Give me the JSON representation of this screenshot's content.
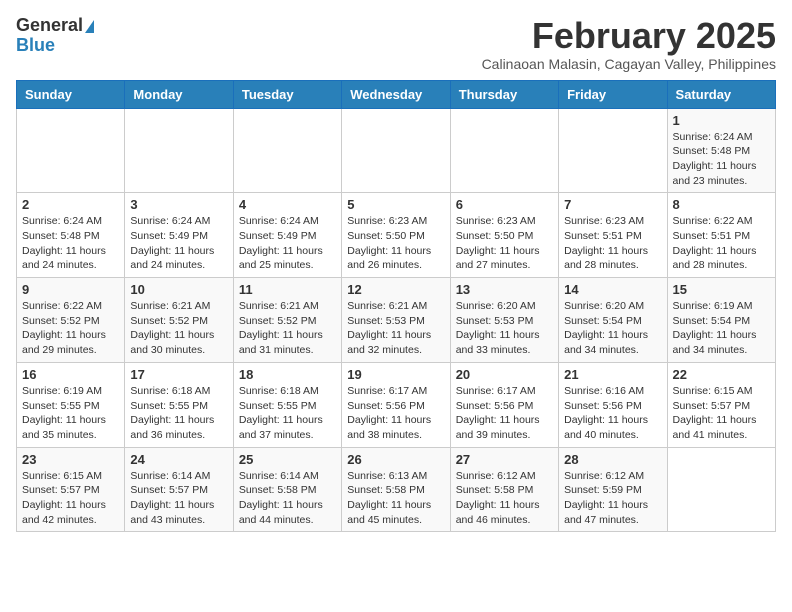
{
  "header": {
    "logo_line1": "General",
    "logo_line2": "Blue",
    "title": "February 2025",
    "subtitle": "Calinaoan Malasin, Cagayan Valley, Philippines"
  },
  "calendar": {
    "days_of_week": [
      "Sunday",
      "Monday",
      "Tuesday",
      "Wednesday",
      "Thursday",
      "Friday",
      "Saturday"
    ],
    "weeks": [
      [
        {
          "day": "",
          "info": ""
        },
        {
          "day": "",
          "info": ""
        },
        {
          "day": "",
          "info": ""
        },
        {
          "day": "",
          "info": ""
        },
        {
          "day": "",
          "info": ""
        },
        {
          "day": "",
          "info": ""
        },
        {
          "day": "1",
          "info": "Sunrise: 6:24 AM\nSunset: 5:48 PM\nDaylight: 11 hours and 23 minutes."
        }
      ],
      [
        {
          "day": "2",
          "info": "Sunrise: 6:24 AM\nSunset: 5:48 PM\nDaylight: 11 hours and 24 minutes."
        },
        {
          "day": "3",
          "info": "Sunrise: 6:24 AM\nSunset: 5:49 PM\nDaylight: 11 hours and 24 minutes."
        },
        {
          "day": "4",
          "info": "Sunrise: 6:24 AM\nSunset: 5:49 PM\nDaylight: 11 hours and 25 minutes."
        },
        {
          "day": "5",
          "info": "Sunrise: 6:23 AM\nSunset: 5:50 PM\nDaylight: 11 hours and 26 minutes."
        },
        {
          "day": "6",
          "info": "Sunrise: 6:23 AM\nSunset: 5:50 PM\nDaylight: 11 hours and 27 minutes."
        },
        {
          "day": "7",
          "info": "Sunrise: 6:23 AM\nSunset: 5:51 PM\nDaylight: 11 hours and 28 minutes."
        },
        {
          "day": "8",
          "info": "Sunrise: 6:22 AM\nSunset: 5:51 PM\nDaylight: 11 hours and 28 minutes."
        }
      ],
      [
        {
          "day": "9",
          "info": "Sunrise: 6:22 AM\nSunset: 5:52 PM\nDaylight: 11 hours and 29 minutes."
        },
        {
          "day": "10",
          "info": "Sunrise: 6:21 AM\nSunset: 5:52 PM\nDaylight: 11 hours and 30 minutes."
        },
        {
          "day": "11",
          "info": "Sunrise: 6:21 AM\nSunset: 5:52 PM\nDaylight: 11 hours and 31 minutes."
        },
        {
          "day": "12",
          "info": "Sunrise: 6:21 AM\nSunset: 5:53 PM\nDaylight: 11 hours and 32 minutes."
        },
        {
          "day": "13",
          "info": "Sunrise: 6:20 AM\nSunset: 5:53 PM\nDaylight: 11 hours and 33 minutes."
        },
        {
          "day": "14",
          "info": "Sunrise: 6:20 AM\nSunset: 5:54 PM\nDaylight: 11 hours and 34 minutes."
        },
        {
          "day": "15",
          "info": "Sunrise: 6:19 AM\nSunset: 5:54 PM\nDaylight: 11 hours and 34 minutes."
        }
      ],
      [
        {
          "day": "16",
          "info": "Sunrise: 6:19 AM\nSunset: 5:55 PM\nDaylight: 11 hours and 35 minutes."
        },
        {
          "day": "17",
          "info": "Sunrise: 6:18 AM\nSunset: 5:55 PM\nDaylight: 11 hours and 36 minutes."
        },
        {
          "day": "18",
          "info": "Sunrise: 6:18 AM\nSunset: 5:55 PM\nDaylight: 11 hours and 37 minutes."
        },
        {
          "day": "19",
          "info": "Sunrise: 6:17 AM\nSunset: 5:56 PM\nDaylight: 11 hours and 38 minutes."
        },
        {
          "day": "20",
          "info": "Sunrise: 6:17 AM\nSunset: 5:56 PM\nDaylight: 11 hours and 39 minutes."
        },
        {
          "day": "21",
          "info": "Sunrise: 6:16 AM\nSunset: 5:56 PM\nDaylight: 11 hours and 40 minutes."
        },
        {
          "day": "22",
          "info": "Sunrise: 6:15 AM\nSunset: 5:57 PM\nDaylight: 11 hours and 41 minutes."
        }
      ],
      [
        {
          "day": "23",
          "info": "Sunrise: 6:15 AM\nSunset: 5:57 PM\nDaylight: 11 hours and 42 minutes."
        },
        {
          "day": "24",
          "info": "Sunrise: 6:14 AM\nSunset: 5:57 PM\nDaylight: 11 hours and 43 minutes."
        },
        {
          "day": "25",
          "info": "Sunrise: 6:14 AM\nSunset: 5:58 PM\nDaylight: 11 hours and 44 minutes."
        },
        {
          "day": "26",
          "info": "Sunrise: 6:13 AM\nSunset: 5:58 PM\nDaylight: 11 hours and 45 minutes."
        },
        {
          "day": "27",
          "info": "Sunrise: 6:12 AM\nSunset: 5:58 PM\nDaylight: 11 hours and 46 minutes."
        },
        {
          "day": "28",
          "info": "Sunrise: 6:12 AM\nSunset: 5:59 PM\nDaylight: 11 hours and 47 minutes."
        },
        {
          "day": "",
          "info": ""
        }
      ]
    ]
  }
}
